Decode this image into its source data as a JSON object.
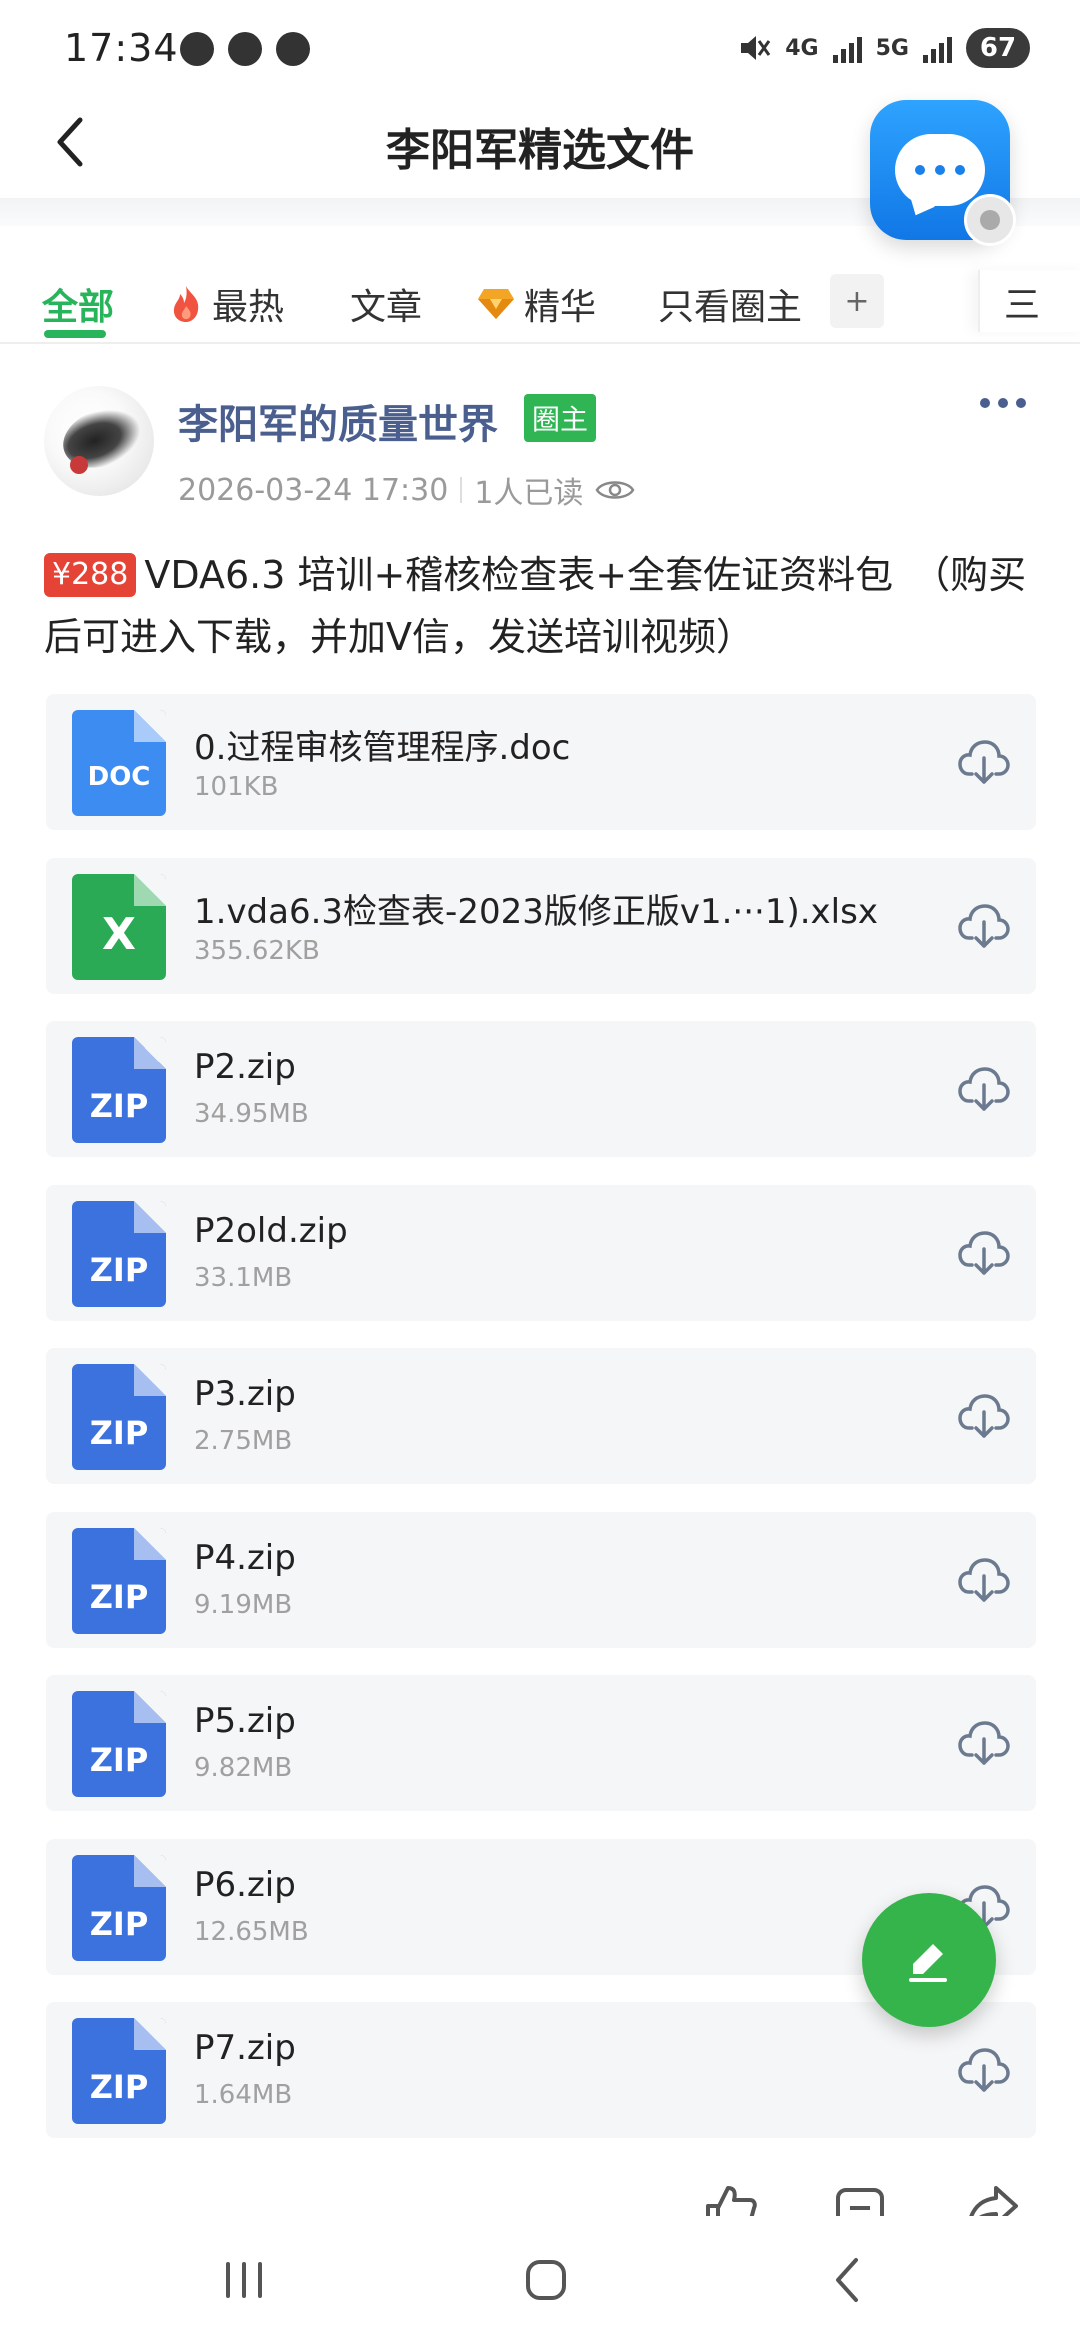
{
  "status_bar": {
    "time": "17:34",
    "battery": "67",
    "network_1": "4G",
    "network_2": "5G",
    "icons": [
      "chat-bubble-icon",
      "weibo-icon",
      "account-icon",
      "mute-icon",
      "signal-icon"
    ]
  },
  "header": {
    "title": "李阳军精选文件"
  },
  "tabs": [
    {
      "label": "全部",
      "active": true
    },
    {
      "label": "最热",
      "icon": "flame-icon"
    },
    {
      "label": "文章"
    },
    {
      "label": "精华",
      "icon": "gem-icon"
    },
    {
      "label": "只看圈主"
    }
  ],
  "tab_plus": "+",
  "tab_menu": "三",
  "post": {
    "author": "李阳军的质量世界",
    "badge": "圈主",
    "timestamp": "2026-03-24 17:30",
    "read_count": "1人已读",
    "price": "¥288",
    "text": "VDA6.3 培训+稽核检查表+全套佐证资料包　（购买后可进入下载，并加V信，发送培训视频）"
  },
  "files": [
    {
      "type": "doc",
      "type_label": "DOC",
      "name": "0.过程审核管理程序.doc",
      "size": "101KB"
    },
    {
      "type": "xlsx",
      "type_label": "X",
      "name": "1.vda6.3检查表-2023版修正版v1.···1).xlsx",
      "size": "355.62KB"
    },
    {
      "type": "zip",
      "type_label": "ZIP",
      "name": "P2.zip",
      "size": "34.95MB"
    },
    {
      "type": "zip",
      "type_label": "ZIP",
      "name": "P2old.zip",
      "size": "33.1MB"
    },
    {
      "type": "zip",
      "type_label": "ZIP",
      "name": "P3.zip",
      "size": "2.75MB"
    },
    {
      "type": "zip",
      "type_label": "ZIP",
      "name": "P4.zip",
      "size": "9.19MB"
    },
    {
      "type": "zip",
      "type_label": "ZIP",
      "name": "P5.zip",
      "size": "9.82MB"
    },
    {
      "type": "zip",
      "type_label": "ZIP",
      "name": "P6.zip",
      "size": "12.65MB"
    },
    {
      "type": "zip",
      "type_label": "ZIP",
      "name": "P7.zip",
      "size": "1.64MB"
    }
  ],
  "colors": {
    "accent_green": "#28b45a",
    "author_blue": "#4b5f8f",
    "price_red": "#e54335",
    "file_blue": "#3c72de",
    "excel_green": "#2aaa54"
  }
}
